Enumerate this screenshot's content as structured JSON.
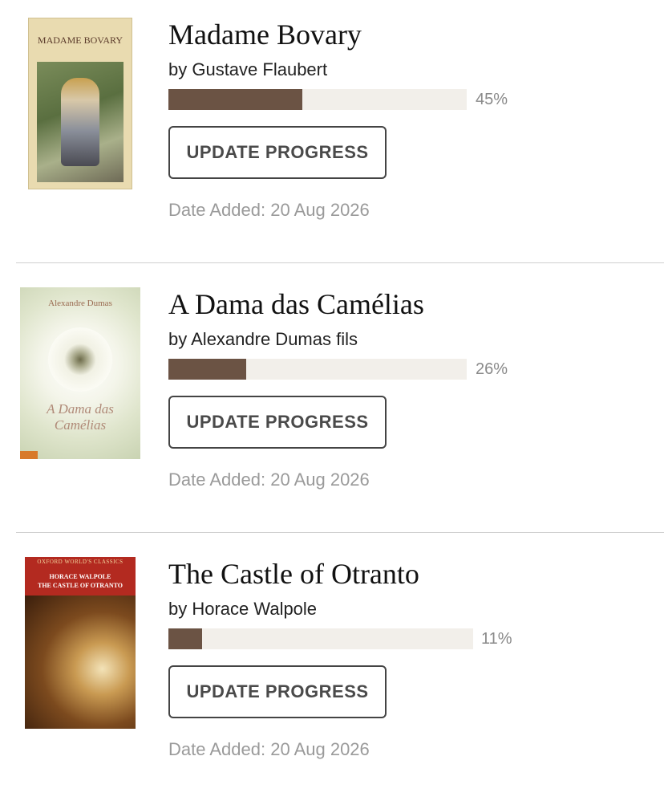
{
  "books": [
    {
      "title": "Madame Bovary",
      "author": "by Gustave Flaubert",
      "progress": 0.45,
      "progress_label": "45%",
      "button_label": "UPDATE PROGRESS",
      "date_added": "Date Added: 20 Aug 2026",
      "cover_text": "MADAME BOVARY",
      "cover_bg": "#e9dbb0",
      "cover_art": "#6f8453"
    },
    {
      "title": "A Dama das Camélias",
      "author": "by Alexandre Dumas fils",
      "progress": 0.26,
      "progress_label": "26%",
      "button_label": "UPDATE PROGRESS",
      "date_added": "Date Added: 20 Aug 2026",
      "cover_text": "Alexandre Dumas",
      "cover_text2": "A Dama das Camélias",
      "cover_bg": "#e6ead9",
      "cover_art": "#f6f6ee"
    },
    {
      "title": "The Castle of Otranto",
      "author": "by Horace Walpole",
      "progress": 0.11,
      "progress_label": "11%",
      "button_label": "UPDATE PROGRESS",
      "date_added": "Date Added: 20 Aug 2026",
      "cover_text": "OXFORD WORLD'S CLASSICS",
      "cover_text2": "HORACE WALPOLE",
      "cover_text3": "THE CASTLE OF OTRANTO",
      "cover_bg": "#b32a20",
      "cover_art": "#7c4a1e"
    }
  ],
  "colors": {
    "bar_fill": "#6b5344",
    "bar_track": "#f2efea",
    "button_border": "#444444"
  }
}
